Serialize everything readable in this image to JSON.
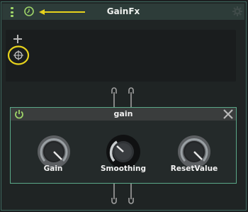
{
  "window": {
    "title": "GainFx"
  },
  "icons": {
    "menu": "vertical-dots-icon",
    "clock": "clock-icon",
    "settings": "gear-icon",
    "add": "plus-icon",
    "target": "crosshair-icon",
    "power": "power-icon",
    "close": "close-icon"
  },
  "node": {
    "title": "gain",
    "knobs": [
      {
        "label": "Gain"
      },
      {
        "label": "Smoothing"
      },
      {
        "label": "ResetValue"
      }
    ]
  },
  "colors": {
    "accent_green": "#9ed468",
    "annotation_yellow": "#e6d21c",
    "border_teal": "#3f6a60",
    "node_border": "#5aa888"
  }
}
